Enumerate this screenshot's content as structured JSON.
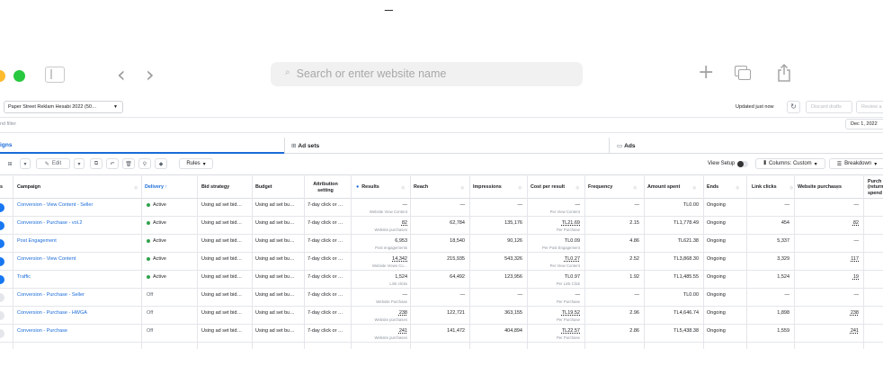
{
  "browser": {
    "traffic_colors": {
      "close": "#fd5f57",
      "minimize": "#febb2e",
      "maximize": "#28c840"
    },
    "address_placeholder": "Search or enter website name",
    "top_text": "_"
  },
  "account": {
    "selector_label": "Paper Street Reklam Hesabi 2022 (50…",
    "updated_text": "Updated just now",
    "discard_label": "Discard drafts",
    "review_label": "Review a",
    "filter_placeholder": "nd filter",
    "date_label": "Dec 1, 2022"
  },
  "tabs": {
    "campaigns": "igns",
    "adsets": "Ad sets",
    "ads": "Ads"
  },
  "toolbar": {
    "edit_label": "Edit",
    "rules_label": "Rules",
    "view_setup_label": "View Setup",
    "columns_label": "Columns: Custom",
    "breakdown_label": "Breakdown"
  },
  "headers": {
    "s": "s",
    "campaign": "Campaign",
    "delivery": "Delivery ↑",
    "bid": "Bid strategy",
    "budget": "Budget",
    "attribution": "Attribution setting",
    "results": "Results",
    "reach": "Reach",
    "impressions": "Impressions",
    "cpr": "Cost per result",
    "frequency": "Frequency",
    "amount": "Amount spent",
    "ends": "Ends",
    "link_clicks": "Link clicks",
    "website_purchases": "Website purchases",
    "purch": "Purch (return spend"
  },
  "colors": {
    "active": "#31a24c",
    "link": "#1a6bd8",
    "toggle_on": "#1877f2",
    "toggle_off": "#e4e6eb"
  },
  "rows": [
    {
      "on": true,
      "campaign": "Conversion - View Content - Seller",
      "delivery": "Active",
      "bid": "Using ad set bid…",
      "budget": "Using ad set bu…",
      "attribution": "7-day click or …",
      "results": "—",
      "results_sub": "Website View Content",
      "reach": "—",
      "impressions": "—",
      "cpr": "—",
      "cpr_sub": "Per View Content",
      "frequency": "—",
      "amount": "TL0.00",
      "ends": "Ongoing",
      "link_clicks": "—",
      "website_purchases": "—"
    },
    {
      "on": true,
      "campaign": "Conversion - Purchase - vol.2",
      "delivery": "Active",
      "bid": "Using ad set bid…",
      "budget": "Using ad set bu…",
      "attribution": "7-day click or …",
      "results": "82",
      "results_sub": "Website purchases",
      "reach": "62,784",
      "impressions": "135,176",
      "cpr": "TL21.69",
      "cpr_sub": "Per Purchase",
      "frequency": "2.15",
      "amount": "TL1,778.49",
      "ends": "Ongoing",
      "link_clicks": "454",
      "website_purchases": "82"
    },
    {
      "on": true,
      "campaign": "Post Engagement",
      "delivery": "Active",
      "bid": "Using ad set bid…",
      "budget": "Using ad set bu…",
      "attribution": "7-day click or …",
      "results": "6,953",
      "results_sub": "Post engagements",
      "reach": "18,540",
      "impressions": "90,126",
      "cpr": "TL0.09",
      "cpr_sub": "Per Post Engagement",
      "frequency": "4.86",
      "amount": "TL621.38",
      "ends": "Ongoing",
      "link_clicks": "5,337",
      "website_purchases": "—"
    },
    {
      "on": true,
      "campaign": "Conversion - View Content",
      "delivery": "Active",
      "bid": "Using ad set bid…",
      "budget": "Using ad set bu…",
      "attribution": "7-day click or …",
      "results": "14,342",
      "results_sub": "Website Views Co…",
      "reach": "215,935",
      "impressions": "543,326",
      "cpr": "TL0.27",
      "cpr_sub": "Per View Content",
      "frequency": "2.52",
      "amount": "TL3,868.30",
      "ends": "Ongoing",
      "link_clicks": "3,329",
      "website_purchases": "117"
    },
    {
      "on": true,
      "campaign": "Traffic",
      "delivery": "Active",
      "bid": "Using ad set bid…",
      "budget": "Using ad set bu…",
      "attribution": "7-day click or …",
      "results": "1,524",
      "results_sub": "Link clicks",
      "reach": "64,492",
      "impressions": "123,956",
      "cpr": "TL0.97",
      "cpr_sub": "Per Link Click",
      "frequency": "1.92",
      "amount": "TL1,485.55",
      "ends": "Ongoing",
      "link_clicks": "1,524",
      "website_purchases": "19"
    },
    {
      "on": false,
      "campaign": "Conversion - Purchase - Seller",
      "delivery": "Off",
      "bid": "Using ad set bid…",
      "budget": "Using ad set bu…",
      "attribution": "7-day click or …",
      "results": "—",
      "results_sub": "Website Purchase",
      "reach": "—",
      "impressions": "—",
      "cpr": "—",
      "cpr_sub": "Per Purchase",
      "frequency": "—",
      "amount": "TL0.00",
      "ends": "Ongoing",
      "link_clicks": "—",
      "website_purchases": "—"
    },
    {
      "on": false,
      "campaign": "Conversion - Purchase - HWGA",
      "delivery": "Off",
      "bid": "Using ad set bid…",
      "budget": "Using ad set bu…",
      "attribution": "7-day click or …",
      "results": "238",
      "results_sub": "Website purchases",
      "reach": "122,721",
      "impressions": "363,155",
      "cpr": "TL19.52",
      "cpr_sub": "Per Purchase",
      "frequency": "2.96",
      "amount": "TL4,646.74",
      "ends": "Ongoing",
      "link_clicks": "1,898",
      "website_purchases": "238"
    },
    {
      "on": false,
      "campaign": "Conversion - Purchase",
      "delivery": "Off",
      "bid": "Using ad set bid…",
      "budget": "Using ad set bu…",
      "attribution": "7-day click or …",
      "results": "241",
      "results_sub": "Website purchases",
      "reach": "141,472",
      "impressions": "404,894",
      "cpr": "TL22.57",
      "cpr_sub": "Per Purchase",
      "frequency": "2.86",
      "amount": "TL5,438.38",
      "ends": "Ongoing",
      "link_clicks": "1,559",
      "website_purchases": "241"
    }
  ]
}
